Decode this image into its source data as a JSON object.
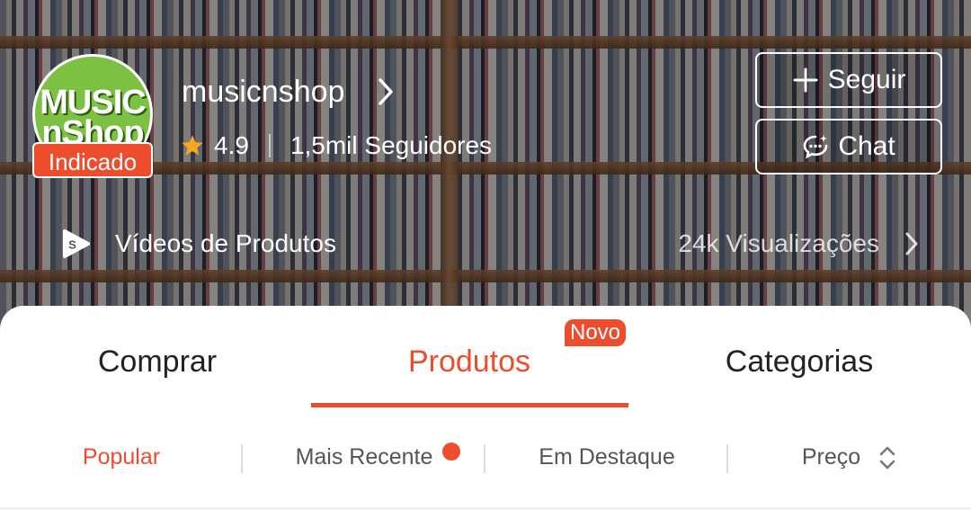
{
  "shop": {
    "logo_line1": "MUSIC",
    "logo_line2": "nShop",
    "badge": "Indicado",
    "name": "musicnshop",
    "rating": "4.9",
    "followers": "1,5mil Seguidores"
  },
  "actions": {
    "follow_label": "Seguir",
    "chat_label": "Chat"
  },
  "videos": {
    "label": "Vídeos de Produtos",
    "views": "24k Visualizações"
  },
  "tabs": [
    {
      "label": "Comprar"
    },
    {
      "label": "Produtos",
      "badge": "Novo",
      "active": true
    },
    {
      "label": "Categorias"
    }
  ],
  "sort": {
    "popular": "Popular",
    "recent": "Mais Recente",
    "featured": "Em Destaque",
    "price": "Preço"
  },
  "colors": {
    "accent": "#ee4d2d",
    "logo_green": "#7cc142",
    "star": "#f5a623"
  }
}
